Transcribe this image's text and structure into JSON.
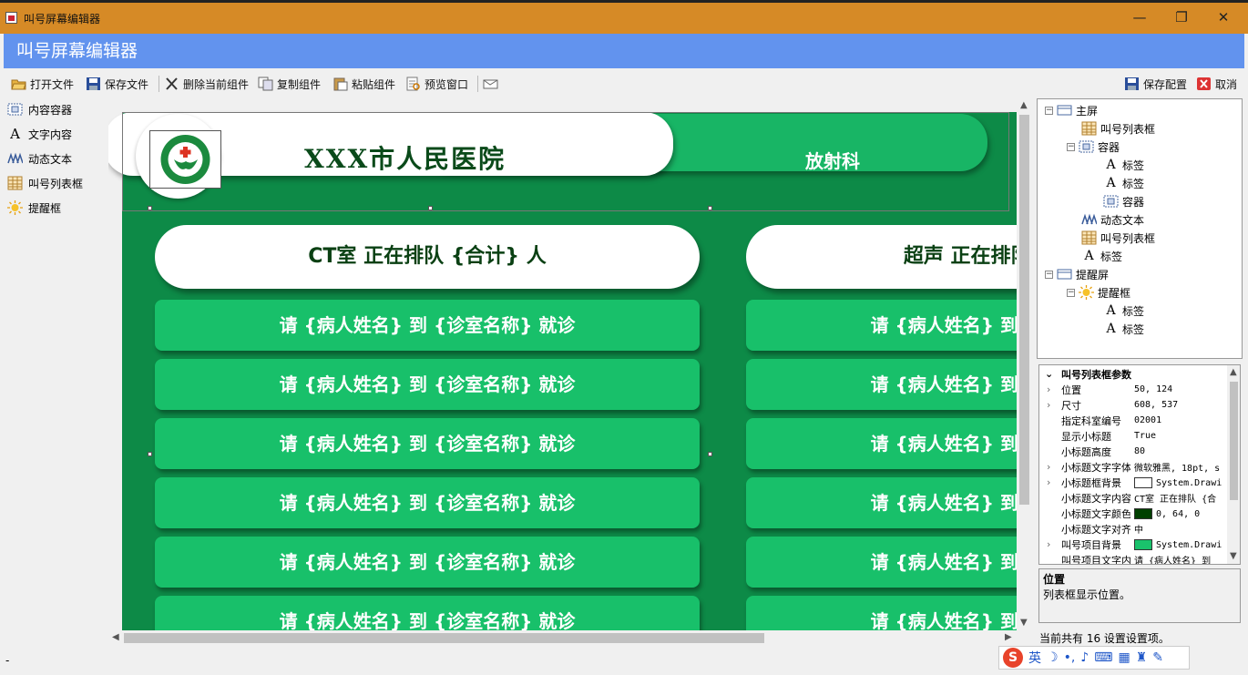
{
  "window": {
    "title": "叫号屏幕编辑器",
    "minimize": "—",
    "restore": "❐",
    "close": "✕"
  },
  "header": {
    "title": "叫号屏幕编辑器"
  },
  "toolbar": {
    "open": "打开文件",
    "save": "保存文件",
    "delete": "删除当前组件",
    "copy": "复制组件",
    "paste": "粘贴组件",
    "preview": "预览窗口",
    "save_config": "保存配置",
    "cancel": "取消"
  },
  "tools": [
    {
      "label": "内容容器",
      "icon": "container-icon"
    },
    {
      "label": "文字内容",
      "icon": "text-icon"
    },
    {
      "label": "动态文本",
      "icon": "dynamic-text-icon"
    },
    {
      "label": "叫号列表框",
      "icon": "list-grid-icon"
    },
    {
      "label": "提醒框",
      "icon": "alert-sun-icon"
    }
  ],
  "screen": {
    "hospital": "XXX市人民医院",
    "department": "放射科",
    "columns": [
      {
        "subtitle": "CT室 正在排队 {合计} 人",
        "items": [
          "请 {病人姓名} 到 {诊室名称} 就诊",
          "请 {病人姓名} 到 {诊室名称} 就诊",
          "请 {病人姓名} 到 {诊室名称} 就诊",
          "请 {病人姓名} 到 {诊室名称} 就诊",
          "请 {病人姓名} 到 {诊室名称} 就诊",
          "请 {病人姓名} 到 {诊室名称} 就诊"
        ]
      },
      {
        "subtitle": "超声 正在排队 {合计} 人",
        "items": [
          "请 {病人姓名} 到 {诊室名称} 就诊",
          "请 {病人姓名} 到 {诊室名称} 就诊",
          "请 {病人姓名} 到 {诊室名称} 就诊",
          "请 {病人姓名} 到 {诊室名称} 就诊",
          "请 {病人姓名} 到 {诊室名称} 就诊",
          "请 {病人姓名} 到 {诊室名称} 就诊"
        ]
      }
    ]
  },
  "tree": [
    {
      "label": "主屏",
      "icon": "screen-icon"
    },
    {
      "label": "叫号列表框",
      "icon": "list-grid-icon"
    },
    {
      "label": "容器",
      "icon": "container-icon"
    },
    {
      "label": "标签",
      "icon": "text-icon"
    },
    {
      "label": "标签",
      "icon": "text-icon"
    },
    {
      "label": "容器",
      "icon": "container-icon"
    },
    {
      "label": "动态文本",
      "icon": "dynamic-text-icon"
    },
    {
      "label": "叫号列表框",
      "icon": "list-grid-icon"
    },
    {
      "label": "标签",
      "icon": "text-icon"
    },
    {
      "label": "提醒屏",
      "icon": "screen-icon"
    },
    {
      "label": "提醒框",
      "icon": "alert-sun-icon"
    },
    {
      "label": "标签",
      "icon": "text-icon"
    },
    {
      "label": "标签",
      "icon": "text-icon"
    }
  ],
  "props": {
    "category": "叫号列表框参数",
    "rows": [
      {
        "name": "位置",
        "value": "50, 124"
      },
      {
        "name": "尺寸",
        "value": "608, 537"
      },
      {
        "name": "指定科室编号",
        "value": "02001"
      },
      {
        "name": "显示小标题",
        "value": "True"
      },
      {
        "name": "小标题高度",
        "value": "80"
      },
      {
        "name": "小标题文字字体",
        "value": "微软雅黑, 18pt, s"
      },
      {
        "name": "小标题框背景",
        "value": "System.Drawi",
        "swatch": "#ffffff"
      },
      {
        "name": "小标题文字内容",
        "value": "CT室 正在排队 {合"
      },
      {
        "name": "小标题文字颜色",
        "value": "0, 64, 0",
        "swatch": "#004000"
      },
      {
        "name": "小标题文字对齐",
        "value": "中"
      },
      {
        "name": "叫号项目背景",
        "value": "System.Drawi",
        "swatch": "#1ac26c"
      },
      {
        "name": "叫号项目文字内容",
        "value": "请 {病人姓名} 到"
      }
    ]
  },
  "description": {
    "title": "位置",
    "text": "列表框显示位置。"
  },
  "status": {
    "count": "当前共有 16 设置设置项。",
    "left": "-"
  },
  "ime": {
    "lang": "英"
  },
  "colors": {
    "titlebar": "#d68a26",
    "header": "#6293ee",
    "screen_bg": "#0d8a47",
    "item_green": "#18c06a"
  }
}
